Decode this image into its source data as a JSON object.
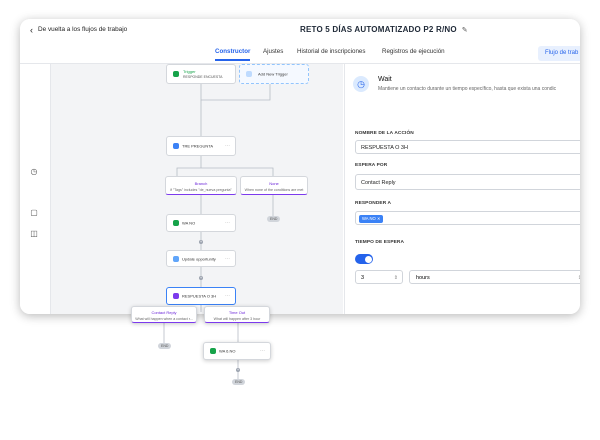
{
  "header": {
    "back_label": "De vuelta a los flujos de trabajo",
    "title": "RETO  5 DÍAS AUTOMATIZADO P2 R/NO",
    "edit_icon": "pencil-icon"
  },
  "tabs": [
    {
      "label": "Constructor",
      "active": true
    },
    {
      "label": "Ajustes",
      "active": false
    },
    {
      "label": "Historial de inscripciones",
      "active": false
    },
    {
      "label": "Registros de ejecución",
      "active": false
    }
  ],
  "flow_button": "Flujo de trab",
  "canvas": {
    "trigger": {
      "title": "Trigger",
      "subtitle": "RESPONDE ENCUESTA"
    },
    "add_trigger": "Add New Trigger",
    "step1": "TRE PREGUNTA",
    "branch": {
      "title": "Branch",
      "subtitle": "if \"Tags\" includes \"de_nueva pregunta\""
    },
    "none": {
      "title": "None",
      "subtitle": "When none of the conditions are met"
    },
    "end_pill_1": "END",
    "step2": "WA NO",
    "step3": "Update opportunity",
    "step4": "RESPUESTA O 3H",
    "contact_reply": {
      "title": "Contact Reply",
      "subtitle": "What will happen when a contact r..."
    },
    "time_out": {
      "title": "Time Out",
      "subtitle": "What will happen after 3 hour"
    },
    "step5": "WA 6.NO",
    "end_pill_2": "END",
    "end_pill_3": "END"
  },
  "panel": {
    "title": "Wait",
    "description": "Mantiene un contacto durante un tiempo específico, hasta que exista una condic",
    "action_name_label": "NOMBRE DE LA ACCIÓN",
    "action_name_value": "RESPUESTA O 3H",
    "wait_for_label": "ESPERA POR",
    "wait_for_value": "Contact Reply",
    "reply_to_label": "RESPONDER A",
    "reply_to_chip": "WA NO  ✕",
    "timeout_label": "TIEMPO DE ESPERA",
    "timeout_enabled": true,
    "timeout_value": "3",
    "timeout_unit": "hours"
  },
  "colors": {
    "accent": "#2563eb",
    "canvas": "#f3f4f6"
  }
}
